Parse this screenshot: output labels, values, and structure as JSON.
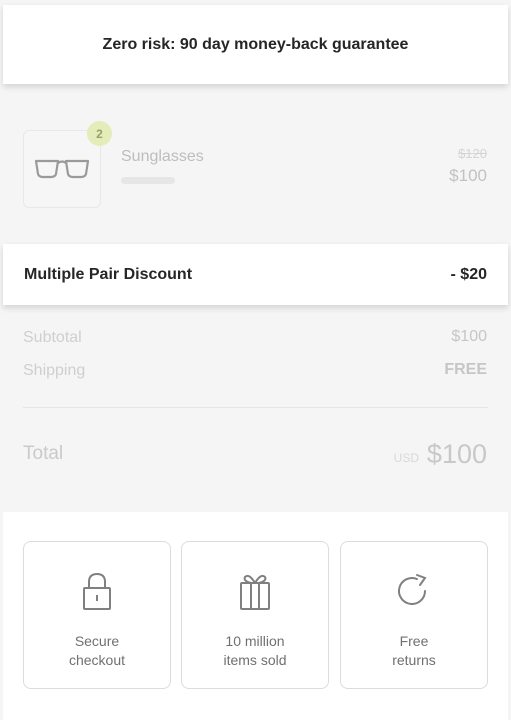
{
  "banner": {
    "text": "Zero risk: 90 day money-back guarantee"
  },
  "product": {
    "name": "Sunglasses",
    "quantity": "2",
    "original_price": "$120",
    "price": "$100",
    "icon": "glasses-icon"
  },
  "discount": {
    "label": "Multiple Pair Discount",
    "amount": "- $20"
  },
  "summary": {
    "subtotal_label": "Subtotal",
    "subtotal_value": "$100",
    "shipping_label": "Shipping",
    "shipping_value": "FREE",
    "total_label": "Total",
    "currency": "USD",
    "total_value": "$100"
  },
  "trust": [
    {
      "label": "Secure\ncheckout",
      "icon": "lock-icon"
    },
    {
      "label": "10 million\nitems sold",
      "icon": "gift-icon"
    },
    {
      "label": "Free\nreturns",
      "icon": "refresh-icon"
    }
  ],
  "colors": {
    "badge_bg": "#e4edb9",
    "text_dark": "#262626",
    "muted": "#c6c6c6"
  }
}
